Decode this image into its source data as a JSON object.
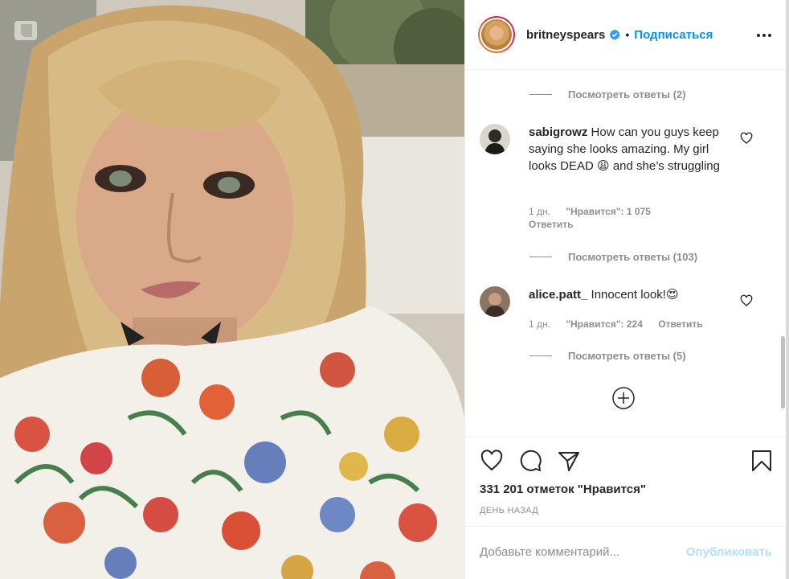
{
  "post": {
    "author": {
      "username": "britneyspears",
      "verified": true,
      "follow_label": "Подписаться",
      "separator": "•"
    },
    "photo": {
      "description_icon": "photo-badge-icon"
    }
  },
  "comments": {
    "view_replies_1": "Посмотреть ответы (2)",
    "items": [
      {
        "username": "sabigrowz",
        "text": "How can you guys keep saying she looks amazing. My girl looks DEAD 😩 and she’s struggling",
        "age": "1 дн.",
        "likes": "\"Нравится\": 1 075",
        "reply_label": "Ответить",
        "view_replies": "Посмотреть ответы (103)"
      },
      {
        "username": "alice.patt_",
        "text": "Innocent look!😍",
        "age": "1 дн.",
        "likes": "\"Нравится\": 224",
        "reply_label": "Ответить",
        "view_replies": "Посмотреть ответы (5)"
      }
    ],
    "load_more_icon": "plus-circle-icon"
  },
  "actions": {
    "icons": [
      "heart-icon",
      "comment-icon",
      "share-icon",
      "bookmark-icon"
    ],
    "likes_text": "331 201 отметок \"Нравится\"",
    "time_ago": "ДЕНЬ НАЗАД"
  },
  "add_comment": {
    "placeholder": "Добавьте комментарий...",
    "post_label": "Опубликовать"
  },
  "colors": {
    "accent": "#0095f6",
    "muted": "#8e8e8e",
    "post_disabled": "#b2dffc"
  }
}
